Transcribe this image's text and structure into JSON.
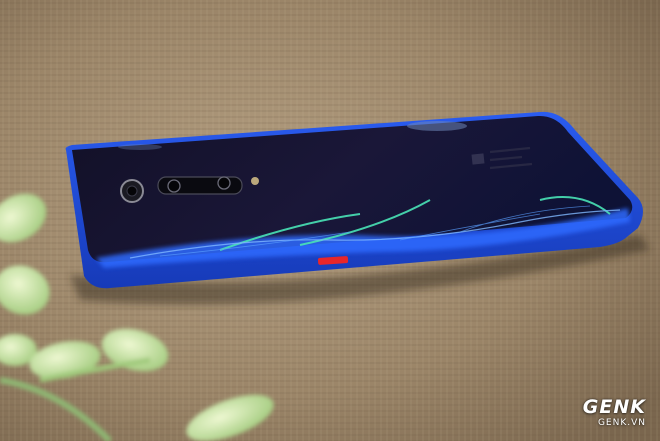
{
  "watermark": {
    "logo": "GENK",
    "domain": "GENK.VN"
  },
  "colors": {
    "fabric": "#a08a6e",
    "phone_back": "#161330",
    "phone_frame": "#1f49d8",
    "glow_blue": "#2f6bff",
    "glow_green": "#49e3b6",
    "power_button": "#e8262a",
    "leaves": "#cfe6a8"
  },
  "icons": [
    "camera-module-icon",
    "flash-icon",
    "leaf-icon"
  ]
}
